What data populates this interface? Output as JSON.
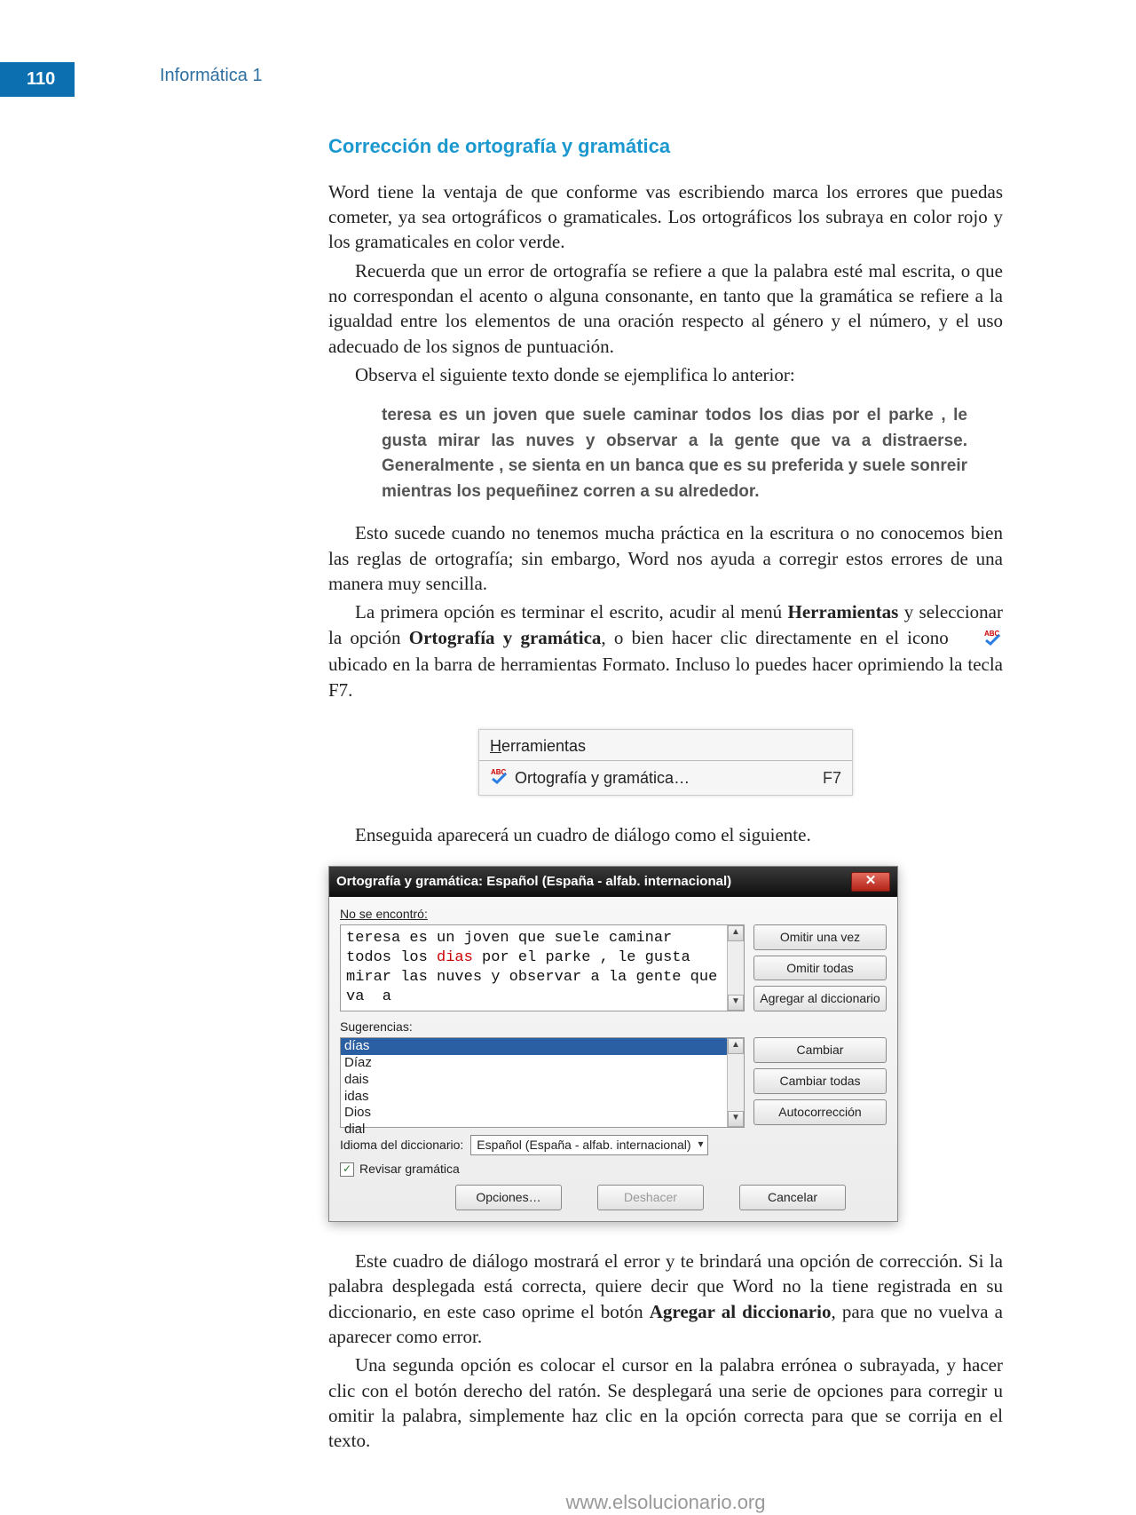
{
  "page_number": "110",
  "running_head": "Informática 1",
  "section_title": "Corrección de ortografía y gramática",
  "para1": "Word tiene la ventaja de que conforme vas escribiendo marca los errores que puedas cometer, ya sea ortográficos o gramaticales. Los ortográficos los subraya en color rojo y los gramaticales en color verde.",
  "para2": "Recuerda que un error de ortografía se refiere a que la palabra esté mal escrita, o que no correspondan el acento o alguna consonante, en tanto que la gramática se refiere a la igualdad entre los elementos de una oración respecto al género y el número, y el uso adecuado de los signos de puntuación.",
  "para3": "Observa el siguiente texto donde se ejemplifica lo anterior:",
  "example": "teresa es un joven que suele caminar todos los dias por el parke , le gusta mirar las nuves y observar a la gente que va  a distraerse. Generalmente , se sienta en un banca que es su preferida y suele sonreir mientras los pequeñinez corren a su alrededor.",
  "para4": "Esto sucede cuando no tenemos mucha práctica en la escritura o no conocemos bien las reglas de ortografía; sin embargo, Word nos ayuda a corregir estos errores de una manera muy sencilla.",
  "para5_a": "La primera opción es terminar el escrito, acudir al menú ",
  "para5_b": "Herramientas",
  "para5_c": " y seleccionar la opción ",
  "para5_d": "Ortografía y gramática",
  "para5_e": ", o bien hacer clic directamente en el icono ",
  "para5_f": " ubicado en la barra de herramientas Formato. Incluso lo puedes hacer oprimiendo la tecla F7.",
  "menu": {
    "title_pre": "H",
    "title_rest": "erramientas",
    "item_label": "Ortografía y gramática…",
    "item_shortcut": "F7"
  },
  "para6": "Enseguida aparecerá un cuadro de diálogo como el siguiente.",
  "dialog": {
    "title": "Ortografía y gramática: Español (España - alfab. internacional)",
    "not_found_label": "No se encontró:",
    "text_pre": "teresa es un joven que suele caminar todos los ",
    "text_err": "dias",
    "text_post": " por el parke , le gusta mirar las nuves y observar a la gente que va  a ",
    "suggestions_label": "Sugerencias:",
    "suggestions_selected": "días",
    "suggestions": [
      "Díaz",
      "dais",
      "idas",
      "Dios",
      "dial"
    ],
    "btn_ignore_once": "Omitir una vez",
    "btn_ignore_all": "Omitir todas",
    "btn_add_dict": "Agregar al diccionario",
    "btn_change": "Cambiar",
    "btn_change_all": "Cambiar todas",
    "btn_autocorrect": "Autocorrección",
    "lang_label": "Idioma del diccionario:",
    "lang_value": "Español (España - alfab. internacional)",
    "check_grammar": "Revisar gramática",
    "btn_options": "Opciones…",
    "btn_undo": "Deshacer",
    "btn_cancel": "Cancelar"
  },
  "para7_a": "Este cuadro de diálogo mostrará el error y te brindará una opción de corrección. Si la palabra desplegada está correcta, quiere decir que Word no la tiene registrada en su diccionario, en este caso oprime el botón ",
  "para7_b": "Agregar al diccionario",
  "para7_c": ", para que no vuelva a aparecer como error.",
  "para8": "Una segunda opción es colocar el cursor en la palabra errónea o subrayada, y hacer clic con el botón derecho del ratón. Se desplegará una serie de opciones para corregir u omitir la palabra, simplemente haz clic en la opción correcta para que se corrija en el texto.",
  "footer_url": "www.elsolucionario.org"
}
